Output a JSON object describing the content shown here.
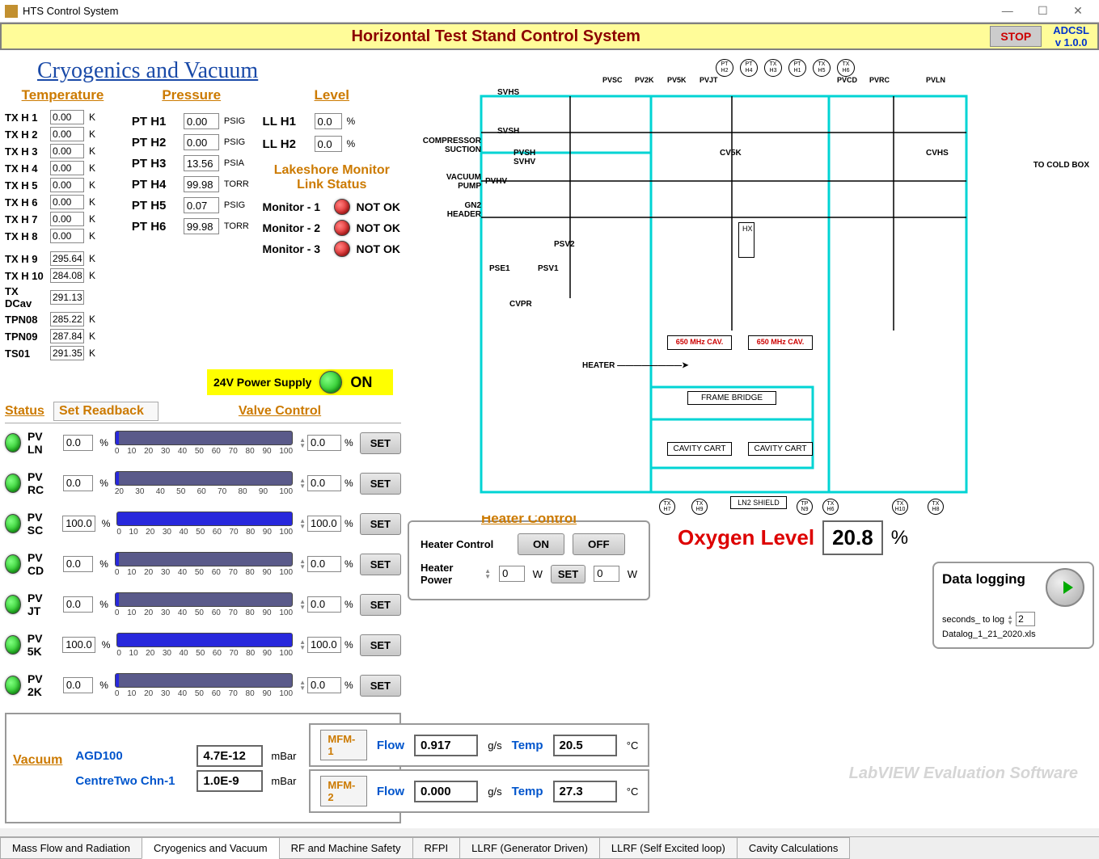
{
  "window_title": "HTS Control System",
  "header": {
    "title": "Horizontal Test Stand Control System",
    "stop": "STOP",
    "version_line1": "ADCSL",
    "version_line2": "v 1.0.0"
  },
  "cryo_title": "Cryogenics and Vacuum",
  "temperature": {
    "header": "Temperature",
    "rows": [
      {
        "label": "TX H 1",
        "value": "0.00",
        "unit": "K"
      },
      {
        "label": "TX H 2",
        "value": "0.00",
        "unit": "K"
      },
      {
        "label": "TX H 3",
        "value": "0.00",
        "unit": "K"
      },
      {
        "label": "TX H 4",
        "value": "0.00",
        "unit": "K"
      },
      {
        "label": "TX H 5",
        "value": "0.00",
        "unit": "K"
      },
      {
        "label": "TX H 6",
        "value": "0.00",
        "unit": "K"
      },
      {
        "label": "TX H 7",
        "value": "0.00",
        "unit": "K"
      },
      {
        "label": "TX H 8",
        "value": "0.00",
        "unit": "K"
      },
      {
        "label": "TX H 9",
        "value": "295.64",
        "unit": "K"
      },
      {
        "label": "TX H 10",
        "value": "284.08",
        "unit": "K"
      },
      {
        "label": "TX DCav",
        "value": "291.13",
        "unit": ""
      },
      {
        "label": "TPN08",
        "value": "285.22",
        "unit": "K"
      },
      {
        "label": "TPN09",
        "value": "287.84",
        "unit": "K"
      },
      {
        "label": "TS01",
        "value": "291.35",
        "unit": "K"
      }
    ]
  },
  "pressure": {
    "header": "Pressure",
    "rows": [
      {
        "label": "PT H1",
        "value": "0.00",
        "unit": "PSIG"
      },
      {
        "label": "PT H2",
        "value": "0.00",
        "unit": "PSIG"
      },
      {
        "label": "PT H3",
        "value": "13.56",
        "unit": "PSIA"
      },
      {
        "label": "PT H4",
        "value": "99.98",
        "unit": "TORR"
      },
      {
        "label": "PT H5",
        "value": "0.07",
        "unit": "PSIG"
      },
      {
        "label": "PT H6",
        "value": "99.98",
        "unit": "TORR"
      }
    ]
  },
  "level": {
    "header": "Level",
    "rows": [
      {
        "label": "LL H1",
        "value": "0.0",
        "unit": "%"
      },
      {
        "label": "LL H2",
        "value": "0.0",
        "unit": "%"
      }
    ]
  },
  "lakeshore": {
    "title1": "Lakeshore Monitor",
    "title2": "Link Status",
    "monitors": [
      {
        "label": "Monitor - 1",
        "status": "NOT OK"
      },
      {
        "label": "Monitor - 2",
        "status": "NOT OK"
      },
      {
        "label": "Monitor - 3",
        "status": "NOT OK"
      }
    ],
    "power_label": "24V Power Supply",
    "power_status": "ON"
  },
  "valve_headers": {
    "status": "Status",
    "readback": "Set Readback",
    "control": "Valve Control"
  },
  "valves": [
    {
      "name": "PV LN",
      "rb": "0.0",
      "unit": "%",
      "set": "0.0",
      "fill": 2,
      "ticks": [
        0,
        10,
        20,
        30,
        40,
        50,
        60,
        70,
        80,
        90,
        100
      ]
    },
    {
      "name": "PV RC",
      "rb": "0.0",
      "unit": "%",
      "set": "0.0",
      "fill": 2,
      "ticks": [
        20,
        30,
        40,
        50,
        60,
        70,
        80,
        90,
        100
      ]
    },
    {
      "name": "PV SC",
      "rb": "100.0",
      "unit": "%",
      "set": "100.0",
      "fill": 100,
      "ticks": [
        0,
        10,
        20,
        30,
        40,
        50,
        60,
        70,
        80,
        90,
        100
      ]
    },
    {
      "name": "PV CD",
      "rb": "0.0",
      "unit": "%",
      "set": "0.0",
      "fill": 2,
      "ticks": [
        0,
        10,
        20,
        30,
        40,
        50,
        60,
        70,
        80,
        90,
        100
      ]
    },
    {
      "name": "PV JT",
      "rb": "0.0",
      "unit": "%",
      "set": "0.0",
      "fill": 2,
      "ticks": [
        0,
        10,
        20,
        30,
        40,
        50,
        60,
        70,
        80,
        90,
        100
      ]
    },
    {
      "name": "PV 5K",
      "rb": "100.0",
      "unit": "%",
      "set": "100.0",
      "fill": 100,
      "ticks": [
        0,
        10,
        20,
        30,
        40,
        50,
        60,
        70,
        80,
        90,
        100
      ]
    },
    {
      "name": "PV 2K",
      "rb": "0.0",
      "unit": "%",
      "set": "0.0",
      "fill": 2,
      "ticks": [
        0,
        10,
        20,
        30,
        40,
        50,
        60,
        70,
        80,
        90,
        100
      ]
    }
  ],
  "set_btn": "SET",
  "heater": {
    "title": "Heater Control",
    "label_ctrl": "Heater Control",
    "on": "ON",
    "off": "OFF",
    "label_pwr": "Heater Power",
    "pwr_in": "0",
    "pwr_unit": "W",
    "set": "SET",
    "pwr_out": "0"
  },
  "oxygen": {
    "label": "Oxygen Level",
    "value": "20.8",
    "unit": "%"
  },
  "datalog": {
    "title": "Data logging",
    "sec_label": "seconds_ to log",
    "sec_val": "2",
    "file": "Datalog_1_21_2020.xls"
  },
  "vacuum": {
    "header": "Vacuum",
    "rows": [
      {
        "label": "AGD100",
        "value": "4.7E-12",
        "unit": "mBar"
      },
      {
        "label": "CentreTwo Chn-1",
        "value": "1.0E-9",
        "unit": "mBar"
      }
    ]
  },
  "mfm": [
    {
      "tag": "MFM-1",
      "flow_lbl": "Flow",
      "flow": "0.917",
      "flow_unit": "g/s",
      "temp_lbl": "Temp",
      "temp": "20.5",
      "temp_unit": "°C"
    },
    {
      "tag": "MFM-2",
      "flow_lbl": "Flow",
      "flow": "0.000",
      "flow_unit": "g/s",
      "temp_lbl": "Temp",
      "temp": "27.3",
      "temp_unit": "°C"
    }
  ],
  "schematic": {
    "top_valves": [
      "PVSC",
      "PV2K",
      "PV5K",
      "PVJT",
      "PVCD",
      "PVRC",
      "PVLN"
    ],
    "pt_circles": [
      "PT H2",
      "PT H4",
      "TX H3",
      "PT H1",
      "TX H5",
      "TX H6"
    ],
    "left_labels": [
      "COMPRESSOR SUCTION",
      "VACUUM PUMP",
      "GN2 HEADER"
    ],
    "labels": [
      "SVHS",
      "SVSH",
      "PVSH",
      "SVHV",
      "PVHV",
      "PSE1",
      "PSV1",
      "PSV2",
      "CVPR",
      "CV5K",
      "CVHS",
      "TO COLD BOX",
      "HX",
      "HEATER",
      "FRAME BRIDGE",
      "LN2 SHIELD"
    ],
    "cav": "650 MHz CAV.",
    "cart": "CAVITY CART",
    "bot_circles": [
      "TX H7",
      "TX H9",
      "TP N9",
      "TX H6",
      "TX H10",
      "TX H8"
    ]
  },
  "tabs": [
    "Mass Flow and Radiation",
    "Cryogenics and Vacuum",
    "RF and Machine Safety",
    "RFPI",
    "LLRF (Generator Driven)",
    "LLRF (Self Excited loop)",
    "Cavity Calculations"
  ],
  "watermark": "LabVIEW Evaluation Software"
}
